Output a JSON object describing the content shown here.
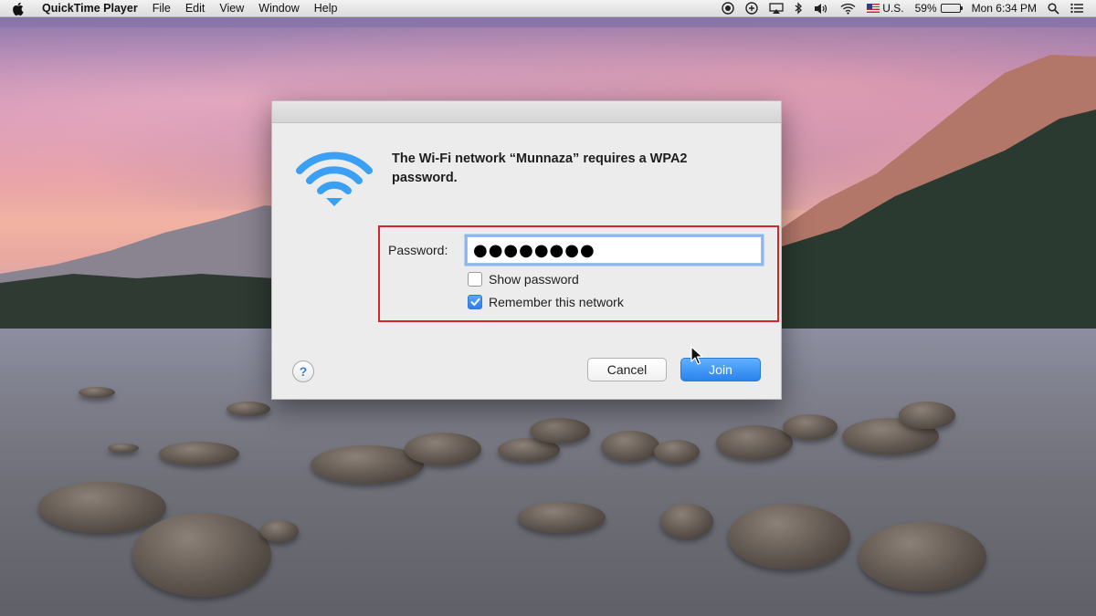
{
  "menubar": {
    "apple": "apple-icon",
    "app_name": "QuickTime Player",
    "menus": [
      "File",
      "Edit",
      "View",
      "Window",
      "Help"
    ],
    "status": {
      "input_source": "U.S.",
      "battery_percent": "59%",
      "battery_level": 0.59,
      "clock": "Mon 6:34 PM"
    }
  },
  "dialog": {
    "message": "The Wi-Fi network “Munnaza” requires a WPA2 password.",
    "password_label": "Password:",
    "password_value": "●●●●●●●●",
    "show_password_label": "Show password",
    "show_password_checked": false,
    "remember_label": "Remember this network",
    "remember_checked": true,
    "help_label": "?",
    "cancel_label": "Cancel",
    "join_label": "Join"
  },
  "colors": {
    "accent_blue": "#2a83ee",
    "highlight_red": "#d3262d",
    "wifi_blue": "#3ba0f3"
  }
}
